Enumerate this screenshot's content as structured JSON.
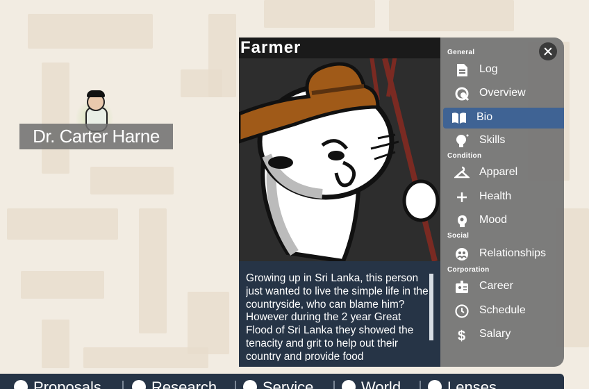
{
  "character": {
    "name": "Dr. Carter Harne"
  },
  "panel": {
    "portrait_title": "Farmer",
    "bio_text": "Growing up in Sri Lanka, this person just wanted to live the simple life in the countryside, who can blame him? However during the 2 year Great Flood of Sri Lanka they showed the tenacity and grit to help out their country and provide food",
    "close_icon": "close-icon",
    "sections": {
      "general": "General",
      "condition": "Condition",
      "social": "Social",
      "corporation": "Corporation"
    },
    "menu": {
      "log": "Log",
      "overview": "Overview",
      "bio": "Bio",
      "skills": "Skills",
      "apparel": "Apparel",
      "health": "Health",
      "mood": "Mood",
      "relationships": "Relationships",
      "career": "Career",
      "schedule": "Schedule",
      "salary": "Salary"
    },
    "active_item": "Bio",
    "accent_color": "#3f6394"
  },
  "bottom_bar": {
    "tabs": [
      "Proposals",
      "Research",
      "Service",
      "World",
      "Lenses"
    ]
  }
}
